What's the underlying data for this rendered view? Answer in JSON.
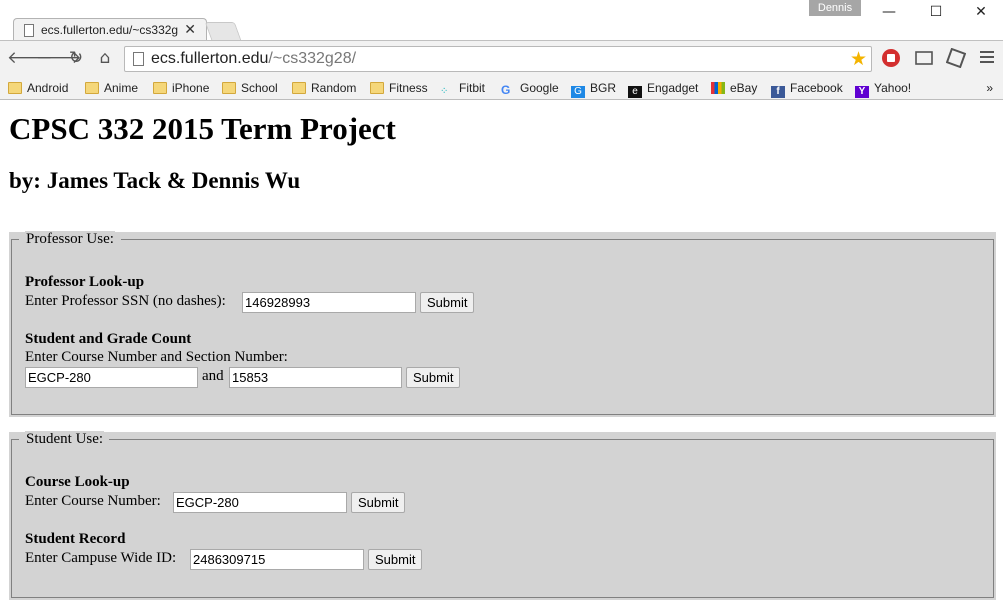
{
  "browser": {
    "tab_title": "ecs.fullerton.edu/~cs332g",
    "tab_close": "✕",
    "profile_name": "Dennis",
    "window_controls": {
      "minimize": "—",
      "maximize": "☐",
      "close": "✕"
    },
    "url_host": "ecs.fullerton.edu",
    "url_path": "/~cs332g28/",
    "bookmarks": [
      {
        "label": "Android",
        "icon": "folder-icon"
      },
      {
        "label": "Anime",
        "icon": "folder-icon"
      },
      {
        "label": "iPhone",
        "icon": "folder-icon"
      },
      {
        "label": "School",
        "icon": "folder-icon"
      },
      {
        "label": "Random",
        "icon": "folder-icon"
      },
      {
        "label": "Fitness",
        "icon": "folder-icon"
      },
      {
        "label": "Fitbit",
        "icon": "fitbit-icon"
      },
      {
        "label": "Google",
        "icon": "google-icon"
      },
      {
        "label": "BGR",
        "icon": "bgr-icon"
      },
      {
        "label": "Engadget",
        "icon": "engadget-icon"
      },
      {
        "label": "eBay",
        "icon": "ebay-icon"
      },
      {
        "label": "Facebook",
        "icon": "facebook-icon"
      },
      {
        "label": "Yahoo!",
        "icon": "yahoo-icon"
      }
    ],
    "bookmarks_overflow": "»"
  },
  "page": {
    "title": "CPSC 332 2015 Term Project",
    "subtitle": "by: James Tack & Dennis Wu",
    "professor_section": {
      "legend": "Professor Use:",
      "lookup": {
        "heading": "Professor Look-up",
        "prompt": "Enter Professor SSN (no dashes):",
        "ssn_value": "146928993",
        "submit_label": "Submit"
      },
      "grade_count": {
        "heading": "Student and Grade Count",
        "prompt": "Enter Course Number and Section Number:",
        "course_value": "EGCP-280",
        "joiner": "and",
        "section_value": "15853",
        "submit_label": "Submit"
      }
    },
    "student_section": {
      "legend": "Student Use:",
      "course_lookup": {
        "heading": "Course Look-up",
        "prompt": "Enter Course Number:",
        "course_value": "EGCP-280",
        "submit_label": "Submit"
      },
      "student_record": {
        "heading": "Student Record",
        "prompt": "Enter Campuse Wide ID:",
        "cwid_value": "2486309715",
        "submit_label": "Submit"
      }
    }
  },
  "colors": {
    "section_bg": "#d3d3d3",
    "star": "#f4b400",
    "stop_ext": "#d32f2f",
    "facebook": "#3b5998",
    "yahoo": "#5f01d1"
  }
}
